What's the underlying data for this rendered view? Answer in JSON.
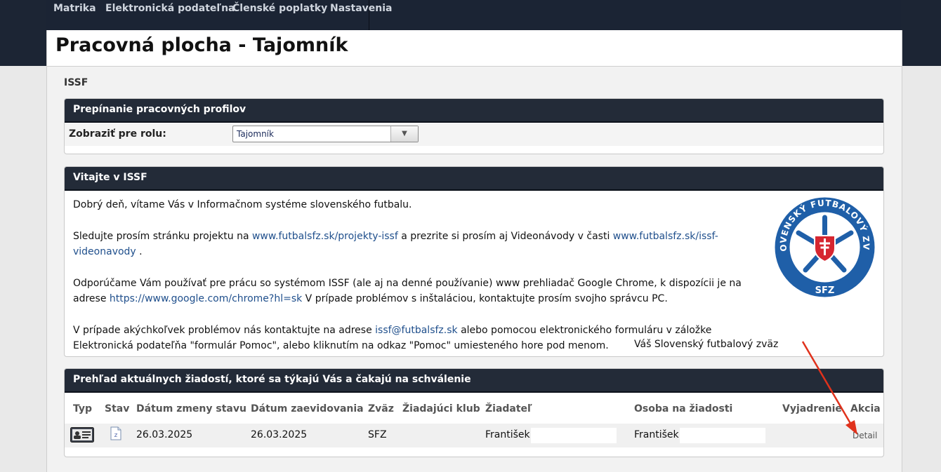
{
  "nav": {
    "items": [
      {
        "label": "Matrika"
      },
      {
        "label": "Elektronická podateľna"
      },
      {
        "label": "Členské poplatky"
      },
      {
        "label": "Nastavenia"
      }
    ]
  },
  "page_title": "Pracovná plocha - Tajomník",
  "section_label": "ISSF",
  "profiles_panel": {
    "title": "Prepínanie pracovných profilov",
    "role_label": "Zobraziť pre rolu:",
    "role_value": "Tajomník"
  },
  "welcome_panel": {
    "title": "Vitajte v ISSF",
    "p1": "Dobrý deň, vítame Vás v Informačnom systéme slovenského futbalu.",
    "p2_a": "Sledujte prosím stránku projektu na ",
    "p2_link1": "www.futbalsfz.sk/projekty-issf",
    "p2_b": " a prezrite si prosím aj Videonávody v časti ",
    "p2_link2": "www.futbalsfz.sk/issf-videonavody",
    "p2_c": " .",
    "p3_a": "Odporúčame Vám používať pre prácu so systémom ISSF (ale aj na denné používanie) www prehliadač Google Chrome, k dispozícii je na adrese ",
    "p3_link": "https://www.google.com/chrome?hl=sk",
    "p3_b": " V prípade problémov s inštaláciou, kontaktujte prosím svojho správcu PC.",
    "p4_a": "V prípade akýchkoľvek problémov nás kontaktujte na adrese ",
    "p4_link": "issf@futbalsfz.sk",
    "p4_b": " alebo pomocou elektronického formuláru v záložke Elektronická podateľňa \"formulár Pomoc\", alebo kliknutím na odkaz \"Pomoc\" umiesteného hore pod menom.",
    "signature": "Váš Slovenský futbalový zväz",
    "logo_text_top": "SLOVENSKÝ FUTBALOVÝ ZVÄZ",
    "logo_text_bottom": "SFZ"
  },
  "requests_panel": {
    "title": "Prehľad aktuálnych žiadostí, ktoré sa týkajú Vás a čakajú na schválenie",
    "columns": [
      "Typ",
      "Stav",
      "Dátum zmeny stavu",
      "Dátum zaevidovania",
      "Zväz",
      "Žiadajúci klub",
      "Žiadateľ",
      "Osoba na žiadosti",
      "Vyjadrenie",
      "Akcia"
    ],
    "rows": [
      {
        "type_icon": "id-card-icon",
        "status_icon": "document-icon",
        "status_changed": "26.03.2025",
        "registered": "26.03.2025",
        "union": "SFZ",
        "club": "",
        "applicant": "František",
        "person": "František",
        "statement": "",
        "action": "Detail"
      }
    ]
  },
  "colors": {
    "header_bg": "#1c2534",
    "panel_header_bg": "#232b38",
    "link": "#1f4f8c",
    "annotation_arrow": "#e0321c",
    "logo_blue": "#1f5fa8",
    "logo_red": "#d62630"
  }
}
